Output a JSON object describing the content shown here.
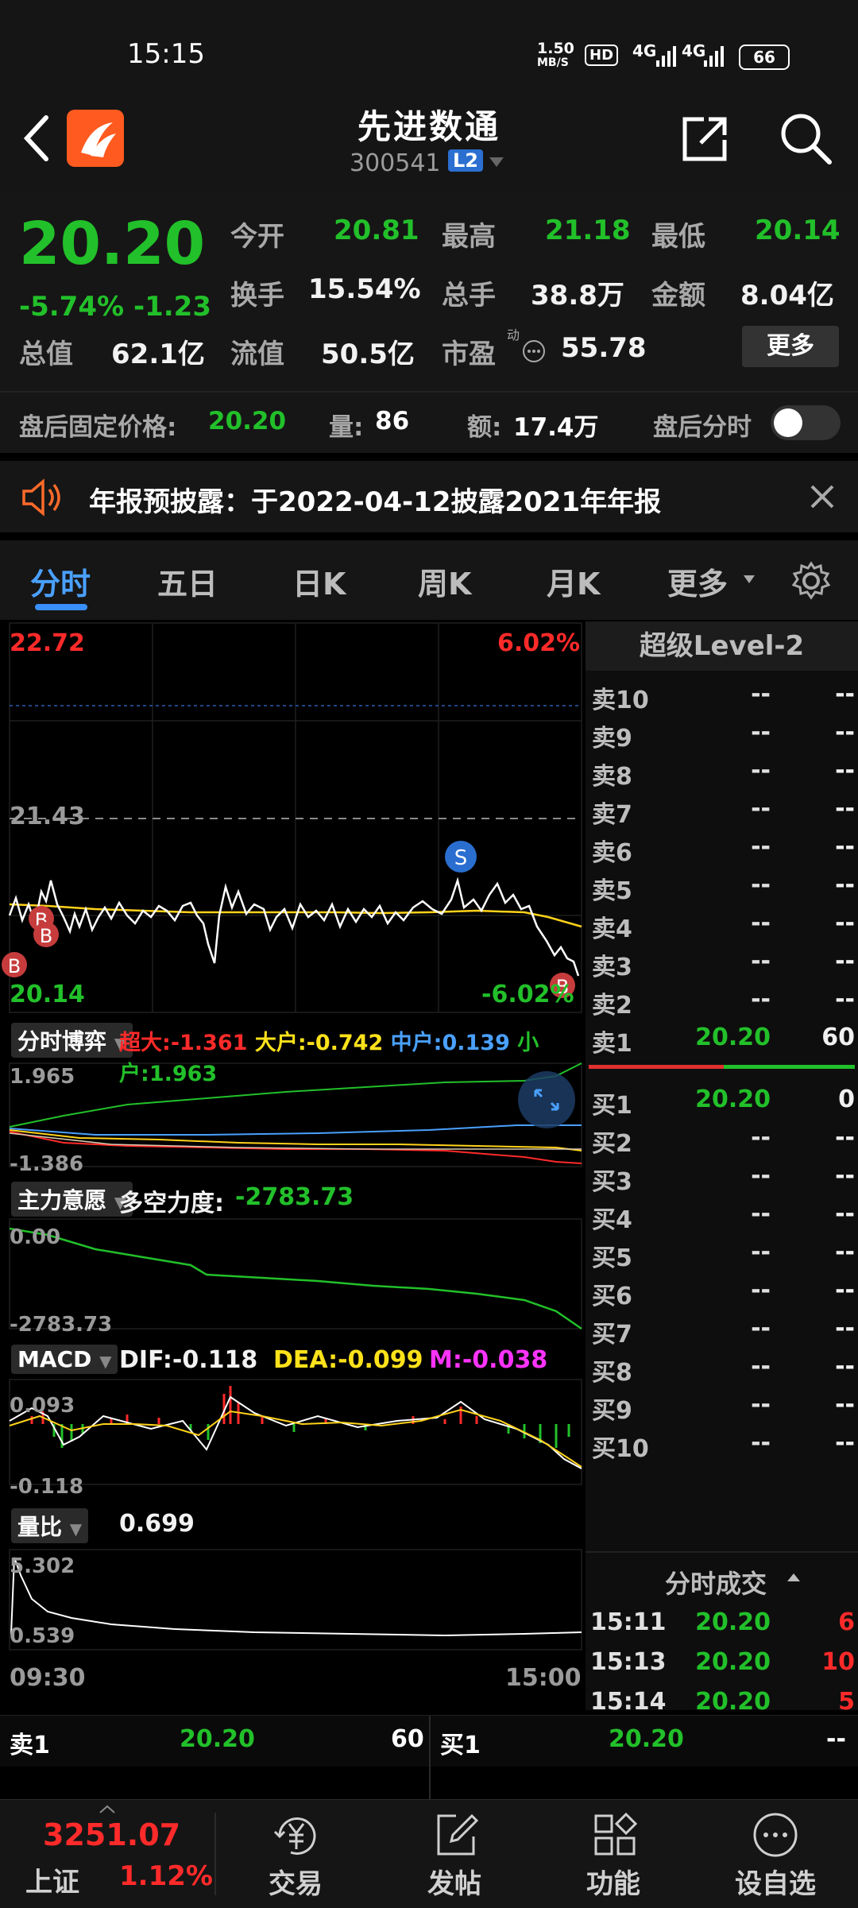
{
  "status_bar": {
    "time": "15:15",
    "speed": "1.50",
    "speed_unit": "MB/S",
    "hd": "HD",
    "net1": "4G",
    "net2": "4G",
    "battery": "66"
  },
  "header": {
    "title": "先进数通",
    "code": "300541",
    "level_badge": "L2"
  },
  "quote": {
    "price": "20.20",
    "change_pct": "-5.74%",
    "change": "-1.23",
    "fields": [
      {
        "label": "今开",
        "value": "20.81"
      },
      {
        "label": "最高",
        "value": "21.18"
      },
      {
        "label": "最低",
        "value": "20.14"
      },
      {
        "label": "换手",
        "value": "15.54%"
      },
      {
        "label": "总手",
        "value": "38.8万"
      },
      {
        "label": "金额",
        "value": "8.04亿"
      },
      {
        "label": "总值",
        "value": "62.1亿"
      },
      {
        "label": "流值",
        "value": "50.5亿"
      },
      {
        "label": "市盈",
        "value": "55.78"
      }
    ],
    "pe_sup": "动",
    "more_label": "更多",
    "after_hours": {
      "label": "盘后固定价格:",
      "price": "20.20",
      "vol_label": "量:",
      "vol": "86",
      "amt_label": "额:",
      "amt": "17.4万",
      "toggle_label": "盘后分时"
    }
  },
  "notice": {
    "text": "年报预披露：于2022-04-12披露2021年年报"
  },
  "tabs": [
    {
      "label": "分时",
      "active": true
    },
    {
      "label": "五日"
    },
    {
      "label": "日K"
    },
    {
      "label": "周K"
    },
    {
      "label": "月K"
    },
    {
      "label": "更多"
    }
  ],
  "chart": {
    "price_high": "22.72",
    "pct_high": "6.02%",
    "prev_close": "21.43",
    "price_low": "20.14",
    "pct_low": "-6.02%",
    "markers": [
      "B",
      "B",
      "B",
      "S",
      "B"
    ],
    "time_start": "09:30",
    "time_end": "15:00"
  },
  "game": {
    "pill": "分时博弈",
    "items": [
      {
        "label": "超大:",
        "value": "-1.361"
      },
      {
        "label": "大户:",
        "value": "-0.742"
      },
      {
        "label": "中户:",
        "value": "0.139"
      },
      {
        "label": "小户:",
        "value": "1.963"
      }
    ],
    "max": "1.965",
    "min": "-1.386"
  },
  "intent": {
    "pill": "主力意愿",
    "label": "多空力度:",
    "value": "-2783.73",
    "max": "0.00",
    "min": "-2783.73"
  },
  "macd": {
    "pill": "MACD",
    "dif": "DIF:-0.118",
    "dea": "DEA:-0.099",
    "m": "M:-0.038",
    "max": "0.093",
    "min": "-0.118"
  },
  "volratio": {
    "pill": "量比",
    "value": "0.699",
    "max": "5.302",
    "min": "0.539"
  },
  "book": {
    "title": "超级Level-2",
    "asks": [
      {
        "label": "卖10",
        "price": "--",
        "vol": "--"
      },
      {
        "label": "卖9",
        "price": "--",
        "vol": "--"
      },
      {
        "label": "卖8",
        "price": "--",
        "vol": "--"
      },
      {
        "label": "卖7",
        "price": "--",
        "vol": "--"
      },
      {
        "label": "卖6",
        "price": "--",
        "vol": "--"
      },
      {
        "label": "卖5",
        "price": "--",
        "vol": "--"
      },
      {
        "label": "卖4",
        "price": "--",
        "vol": "--"
      },
      {
        "label": "卖3",
        "price": "--",
        "vol": "--"
      },
      {
        "label": "卖2",
        "price": "--",
        "vol": "--"
      },
      {
        "label": "卖1",
        "price": "20.20",
        "vol": "60"
      }
    ],
    "bids": [
      {
        "label": "买1",
        "price": "20.20",
        "vol": "0"
      },
      {
        "label": "买2",
        "price": "--",
        "vol": "--"
      },
      {
        "label": "买3",
        "price": "--",
        "vol": "--"
      },
      {
        "label": "买4",
        "price": "--",
        "vol": "--"
      },
      {
        "label": "买5",
        "price": "--",
        "vol": "--"
      },
      {
        "label": "买6",
        "price": "--",
        "vol": "--"
      },
      {
        "label": "买7",
        "price": "--",
        "vol": "--"
      },
      {
        "label": "买8",
        "price": "--",
        "vol": "--"
      },
      {
        "label": "买9",
        "price": "--",
        "vol": "--"
      },
      {
        "label": "买10",
        "price": "--",
        "vol": "--"
      }
    ],
    "trades_title": "分时成交",
    "trades": [
      {
        "time": "15:11",
        "price": "20.20",
        "vol": "6"
      },
      {
        "time": "15:13",
        "price": "20.20",
        "vol": "10"
      },
      {
        "time": "15:14",
        "price": "20.20",
        "vol": "5"
      }
    ]
  },
  "level1": {
    "ask_label": "卖1",
    "ask_price": "20.20",
    "ask_vol": "60",
    "bid_label": "买1",
    "bid_price": "20.20",
    "bid_vol": "--"
  },
  "nav": {
    "index_value": "3251.07",
    "index_name": "上证",
    "index_pct": "1.12%",
    "items": [
      {
        "label": "交易"
      },
      {
        "label": "发帖"
      },
      {
        "label": "功能"
      },
      {
        "label": "设自选"
      }
    ]
  },
  "colors": {
    "up": "#ff2a2a",
    "down": "#22c02a",
    "bg": "#000000",
    "panel": "#161616",
    "accent": "#2b6fd0"
  }
}
